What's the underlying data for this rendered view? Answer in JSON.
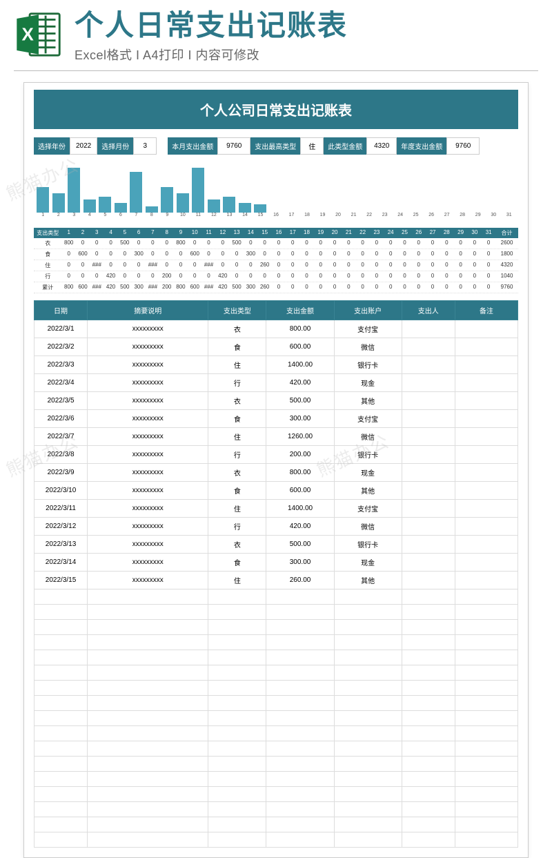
{
  "banner": {
    "title": "个人日常支出记账表",
    "subtitle": "Excel格式 I A4打印 I 内容可修改"
  },
  "sheet_title": "个人公司日常支出记账表",
  "filters": {
    "year_label": "选择年份",
    "year": "2022",
    "month_label": "选择月份",
    "month": "3",
    "monthly_total_label": "本月支出金额",
    "monthly_total": "9760",
    "top_type_label": "支出最高类型",
    "top_type": "住",
    "top_type_amt_label": "此类型金额",
    "top_type_amt": "4320",
    "yearly_total_label": "年度支出金额",
    "yearly_total": "9760"
  },
  "chart_data": {
    "type": "bar",
    "title": "",
    "xlabel": "",
    "ylabel": "",
    "categories": [
      "1",
      "2",
      "3",
      "4",
      "5",
      "6",
      "7",
      "8",
      "9",
      "10",
      "11",
      "12",
      "13",
      "14",
      "15",
      "16",
      "17",
      "18",
      "19",
      "20",
      "21",
      "22",
      "23",
      "24",
      "25",
      "26",
      "27",
      "28",
      "29",
      "30",
      "31"
    ],
    "values": [
      800,
      600,
      1400,
      420,
      500,
      300,
      1260,
      200,
      800,
      600,
      1400,
      420,
      500,
      300,
      260,
      0,
      0,
      0,
      0,
      0,
      0,
      0,
      0,
      0,
      0,
      0,
      0,
      0,
      0,
      0,
      0
    ],
    "ylim": [
      0,
      1500
    ]
  },
  "mini_table": {
    "row_label_header": "支出类型",
    "day_headers": [
      "1",
      "2",
      "3",
      "4",
      "5",
      "6",
      "7",
      "8",
      "9",
      "10",
      "11",
      "12",
      "13",
      "14",
      "15",
      "16",
      "17",
      "18",
      "19",
      "20",
      "21",
      "22",
      "23",
      "24",
      "25",
      "26",
      "27",
      "28",
      "29",
      "30",
      "31"
    ],
    "total_header": "合计",
    "rows": [
      {
        "label": "衣",
        "cells": [
          "800",
          "0",
          "0",
          "0",
          "500",
          "0",
          "0",
          "0",
          "800",
          "0",
          "0",
          "0",
          "500",
          "0",
          "0",
          "0",
          "0",
          "0",
          "0",
          "0",
          "0",
          "0",
          "0",
          "0",
          "0",
          "0",
          "0",
          "0",
          "0",
          "0",
          "0"
        ],
        "total": "2600"
      },
      {
        "label": "食",
        "cells": [
          "0",
          "600",
          "0",
          "0",
          "0",
          "300",
          "0",
          "0",
          "0",
          "600",
          "0",
          "0",
          "0",
          "300",
          "0",
          "0",
          "0",
          "0",
          "0",
          "0",
          "0",
          "0",
          "0",
          "0",
          "0",
          "0",
          "0",
          "0",
          "0",
          "0",
          "0"
        ],
        "total": "1800"
      },
      {
        "label": "住",
        "cells": [
          "0",
          "0",
          "###",
          "0",
          "0",
          "0",
          "###",
          "0",
          "0",
          "0",
          "###",
          "0",
          "0",
          "0",
          "260",
          "0",
          "0",
          "0",
          "0",
          "0",
          "0",
          "0",
          "0",
          "0",
          "0",
          "0",
          "0",
          "0",
          "0",
          "0",
          "0"
        ],
        "total": "4320"
      },
      {
        "label": "行",
        "cells": [
          "0",
          "0",
          "0",
          "420",
          "0",
          "0",
          "0",
          "200",
          "0",
          "0",
          "0",
          "420",
          "0",
          "0",
          "0",
          "0",
          "0",
          "0",
          "0",
          "0",
          "0",
          "0",
          "0",
          "0",
          "0",
          "0",
          "0",
          "0",
          "0",
          "0",
          "0"
        ],
        "total": "1040"
      },
      {
        "label": "累计",
        "cells": [
          "800",
          "600",
          "###",
          "420",
          "500",
          "300",
          "###",
          "200",
          "800",
          "600",
          "###",
          "420",
          "500",
          "300",
          "260",
          "0",
          "0",
          "0",
          "0",
          "0",
          "0",
          "0",
          "0",
          "0",
          "0",
          "0",
          "0",
          "0",
          "0",
          "0",
          "0"
        ],
        "total": "9760"
      }
    ]
  },
  "detail": {
    "headers": {
      "date": "日期",
      "desc": "摘要说明",
      "type": "支出类型",
      "amt": "支出金额",
      "acct": "支出账户",
      "person": "支出人",
      "note": "备注"
    },
    "rows": [
      {
        "date": "2022/3/1",
        "desc": "xxxxxxxxx",
        "type": "衣",
        "amt": "800.00",
        "acct": "支付宝"
      },
      {
        "date": "2022/3/2",
        "desc": "xxxxxxxxx",
        "type": "食",
        "amt": "600.00",
        "acct": "微信"
      },
      {
        "date": "2022/3/3",
        "desc": "xxxxxxxxx",
        "type": "住",
        "amt": "1400.00",
        "acct": "银行卡"
      },
      {
        "date": "2022/3/4",
        "desc": "xxxxxxxxx",
        "type": "行",
        "amt": "420.00",
        "acct": "现金"
      },
      {
        "date": "2022/3/5",
        "desc": "xxxxxxxxx",
        "type": "衣",
        "amt": "500.00",
        "acct": "其他"
      },
      {
        "date": "2022/3/6",
        "desc": "xxxxxxxxx",
        "type": "食",
        "amt": "300.00",
        "acct": "支付宝"
      },
      {
        "date": "2022/3/7",
        "desc": "xxxxxxxxx",
        "type": "住",
        "amt": "1260.00",
        "acct": "微信"
      },
      {
        "date": "2022/3/8",
        "desc": "xxxxxxxxx",
        "type": "行",
        "amt": "200.00",
        "acct": "银行卡"
      },
      {
        "date": "2022/3/9",
        "desc": "xxxxxxxxx",
        "type": "衣",
        "amt": "800.00",
        "acct": "现金"
      },
      {
        "date": "2022/3/10",
        "desc": "xxxxxxxxx",
        "type": "食",
        "amt": "600.00",
        "acct": "其他"
      },
      {
        "date": "2022/3/11",
        "desc": "xxxxxxxxx",
        "type": "住",
        "amt": "1400.00",
        "acct": "支付宝"
      },
      {
        "date": "2022/3/12",
        "desc": "xxxxxxxxx",
        "type": "行",
        "amt": "420.00",
        "acct": "微信"
      },
      {
        "date": "2022/3/13",
        "desc": "xxxxxxxxx",
        "type": "衣",
        "amt": "500.00",
        "acct": "银行卡"
      },
      {
        "date": "2022/3/14",
        "desc": "xxxxxxxxx",
        "type": "食",
        "amt": "300.00",
        "acct": "现金"
      },
      {
        "date": "2022/3/15",
        "desc": "xxxxxxxxx",
        "type": "住",
        "amt": "260.00",
        "acct": "其他"
      }
    ],
    "empty_rows": 17
  },
  "watermark_text": "熊猫办公"
}
